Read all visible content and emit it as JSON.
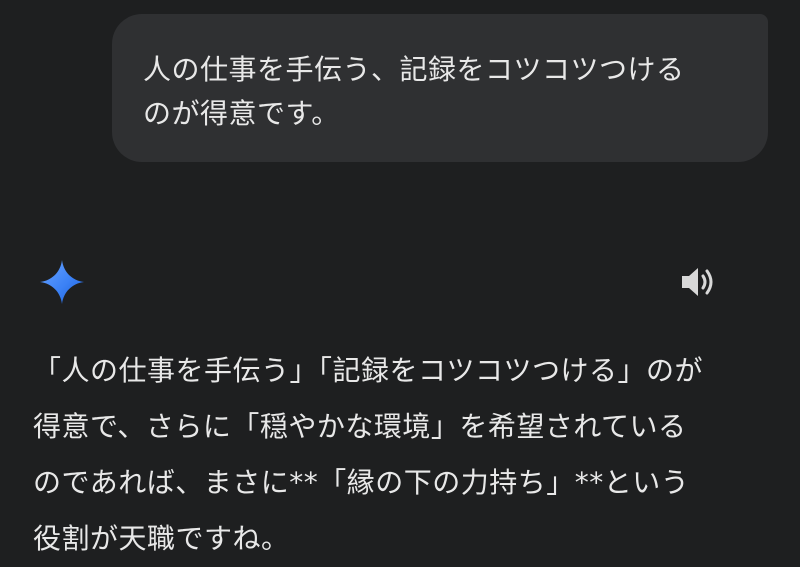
{
  "conversation": {
    "user_message": "人の仕事を手伝う、記録をコツコツつける\nのが得意です。",
    "model_response": "「人の仕事を手伝う」「記録をコツコツつける」のが\n得意で、さらに「穏やかな環境」を希望されている\nのであれば、まさに**「縁の下の力持ち」**という\n役割が天職ですね。"
  },
  "icons": {
    "model": "gemini-spark-icon",
    "speaker": "speaker-icon"
  },
  "colors": {
    "background": "#1e1f20",
    "user_bubble": "#2f3032",
    "text": "#e8e8e8",
    "icon": "#d8d8d8",
    "spark_gradient_start": "#4f8bff",
    "spark_gradient_end": "#1a73e8"
  }
}
